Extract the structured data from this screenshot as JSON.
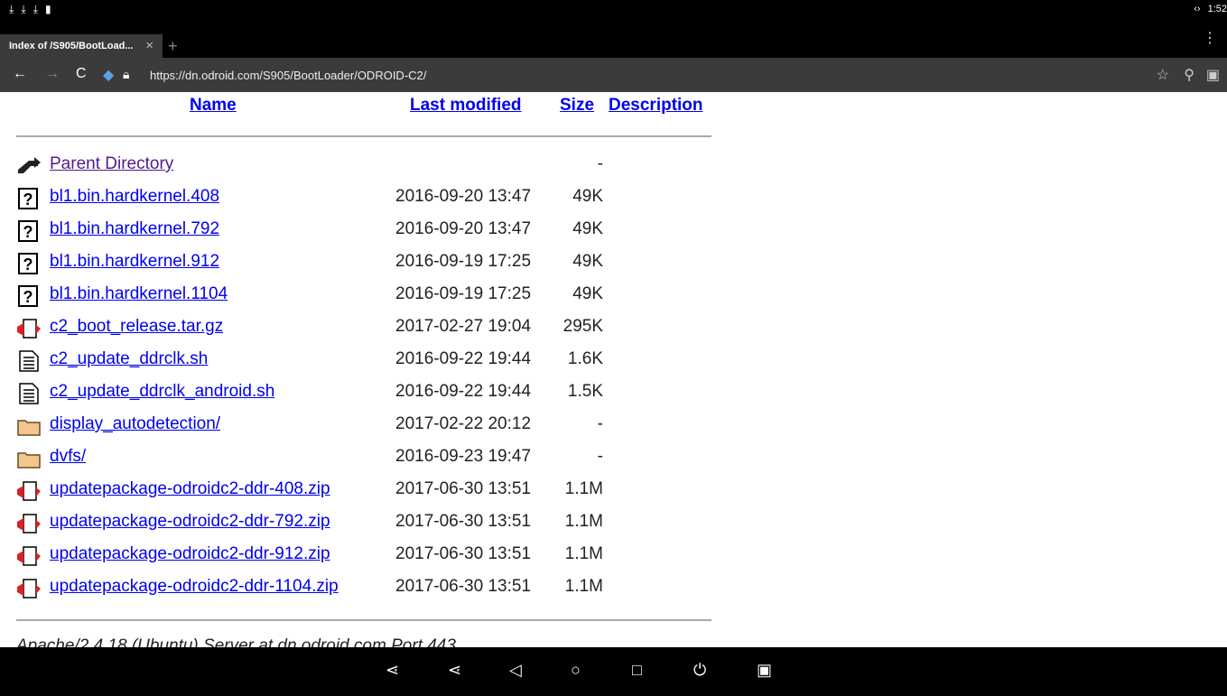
{
  "status": {
    "icons": [
      "download-icon",
      "download-icon",
      "download-icon",
      "clipboard-icon"
    ],
    "time": "1:52"
  },
  "tab": {
    "title": "Index of /S905/BootLoad...",
    "close": "×",
    "new": "+"
  },
  "address": {
    "url": "https://dn.odroid.com/S905/BootLoader/ODROID-C2/"
  },
  "headers": {
    "name": "Name",
    "modified": "Last modified",
    "size": "Size",
    "description": "Description"
  },
  "rows": [
    {
      "icon": "parent",
      "name": "Parent Directory",
      "date": "",
      "size": "-",
      "visited": true
    },
    {
      "icon": "unknown",
      "name": "bl1.bin.hardkernel.408",
      "date": "2016-09-20 13:47",
      "size": "49K"
    },
    {
      "icon": "unknown",
      "name": "bl1.bin.hardkernel.792",
      "date": "2016-09-20 13:47",
      "size": "49K"
    },
    {
      "icon": "unknown",
      "name": "bl1.bin.hardkernel.912",
      "date": "2016-09-19 17:25",
      "size": "49K"
    },
    {
      "icon": "unknown",
      "name": "bl1.bin.hardkernel.1104",
      "date": "2016-09-19 17:25",
      "size": "49K"
    },
    {
      "icon": "archive",
      "name": "c2_boot_release.tar.gz",
      "date": "2017-02-27 19:04",
      "size": "295K"
    },
    {
      "icon": "text",
      "name": "c2_update_ddrclk.sh",
      "date": "2016-09-22 19:44",
      "size": "1.6K"
    },
    {
      "icon": "text",
      "name": "c2_update_ddrclk_android.sh",
      "date": "2016-09-22 19:44",
      "size": "1.5K"
    },
    {
      "icon": "folder",
      "name": "display_autodetection/",
      "date": "2017-02-22 20:12",
      "size": "-"
    },
    {
      "icon": "folder",
      "name": "dvfs/",
      "date": "2016-09-23 19:47",
      "size": "-"
    },
    {
      "icon": "archive",
      "name": "updatepackage-odroidc2-ddr-408.zip",
      "date": "2017-06-30 13:51",
      "size": "1.1M"
    },
    {
      "icon": "archive",
      "name": "updatepackage-odroidc2-ddr-792.zip",
      "date": "2017-06-30 13:51",
      "size": "1.1M"
    },
    {
      "icon": "archive",
      "name": "updatepackage-odroidc2-ddr-912.zip",
      "date": "2017-06-30 13:51",
      "size": "1.1M"
    },
    {
      "icon": "archive",
      "name": "updatepackage-odroidc2-ddr-1104.zip",
      "date": "2017-06-30 13:51",
      "size": "1.1M"
    }
  ],
  "footer": "Apache/2.4.18 (Ubuntu) Server at dn.odroid.com Port 443",
  "navbar": [
    "share-icon",
    "share-icon",
    "back-triangle-icon",
    "home-circle-icon",
    "recents-square-icon",
    "power-icon",
    "screenshot-icon"
  ]
}
